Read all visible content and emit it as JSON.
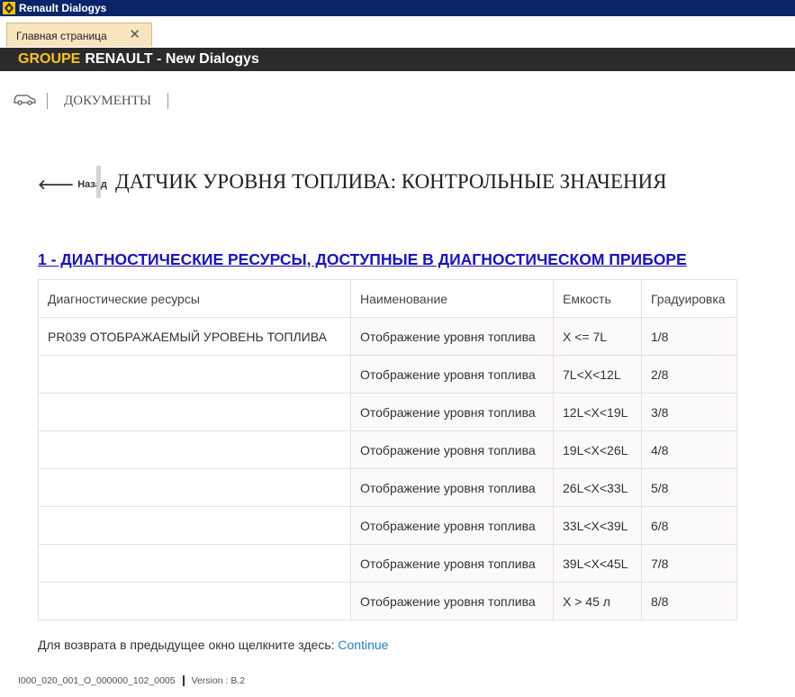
{
  "window": {
    "title": "Renault Dialogys"
  },
  "tabs": [
    {
      "label": "Главная страница",
      "close_symbol": "✕"
    }
  ],
  "brand": {
    "groupe": "GROUPE",
    "rest": "RENAULT -  New Dialogys"
  },
  "nav": {
    "documents": "ДОКУМЕНТЫ"
  },
  "page": {
    "back_label": "Назад",
    "title": "ДАТЧИК УРОВНЯ ТОПЛИВА: КОНТРОЛЬНЫЕ ЗНАЧЕНИЯ",
    "section_title": "1 - ДИАГНОСТИЧЕСКИЕ РЕСУРСЫ, ДОСТУПНЫЕ В ДИАГНОСТИЧЕСКОМ ПРИБОРЕ"
  },
  "table": {
    "headers": [
      "Диагностические ресурсы",
      "Наименование",
      "Емкость",
      "Градуировка"
    ],
    "rows": [
      [
        "PR039 ОТОБРАЖАЕМЫЙ УРОВЕНЬ ТОПЛИВА",
        "Отображение уровня топлива",
        "X <= 7L",
        "1/8"
      ],
      [
        "",
        "Отображение уровня топлива",
        "7L<X<12L",
        "2/8"
      ],
      [
        "",
        "Отображение уровня топлива",
        "12L<X<19L",
        "3/8"
      ],
      [
        "",
        "Отображение уровня топлива",
        "19L<X<26L",
        "4/8"
      ],
      [
        "",
        "Отображение уровня топлива",
        "26L<X<33L",
        "5/8"
      ],
      [
        "",
        "Отображение уровня топлива",
        "33L<X<39L",
        "6/8"
      ],
      [
        "",
        "Отображение уровня топлива",
        "39L<X<45L",
        "7/8"
      ],
      [
        "",
        "Отображение уровня топлива",
        "X > 45 л",
        "8/8"
      ]
    ]
  },
  "return_line": {
    "text": "Для возврата в предыдущее окно щелкните здесь: ",
    "link": "Continue"
  },
  "footer": {
    "doc_id": "I000_020_001_O_000000_102_0005",
    "version": "Version : B.2"
  },
  "icons": {
    "app_logo": "renault-logo-icon",
    "car": "car-icon",
    "back": "arrow-left-icon"
  },
  "colors": {
    "titlebar": "#0a246a",
    "tab": "#f9e4c0",
    "brandbar": "#2b2b2b",
    "groupe": "#f7c41f",
    "section_link": "#1a12c8",
    "continue_link": "#2a7fc6"
  }
}
